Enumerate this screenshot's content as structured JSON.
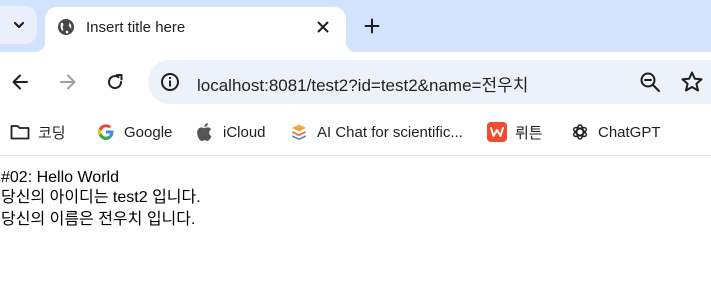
{
  "browser": {
    "tab": {
      "title": "Insert title here"
    },
    "address_bar": {
      "url": "localhost:8081/test2?id=test2&name=전우치"
    }
  },
  "bookmarks": [
    {
      "label": "코딩",
      "icon": "folder-icon"
    },
    {
      "label": "Google",
      "icon": "google-icon"
    },
    {
      "label": "iCloud",
      "icon": "apple-icon"
    },
    {
      "label": "AI Chat for scientific...",
      "icon": "stack-icon"
    },
    {
      "label": "뤼튼",
      "icon": "wrtn-icon"
    },
    {
      "label": "ChatGPT",
      "icon": "chatgpt-icon"
    }
  ],
  "page": {
    "lines": [
      "#02: Hello World",
      "당신의 아이디는 test2 입니다.",
      "당신의 이름은 전우치 입니다."
    ]
  },
  "colors": {
    "tabstrip_bg": "#d3e3fd",
    "omnibox_bg": "#edf2fa",
    "wrtn_brand": "#ef4d2b"
  }
}
